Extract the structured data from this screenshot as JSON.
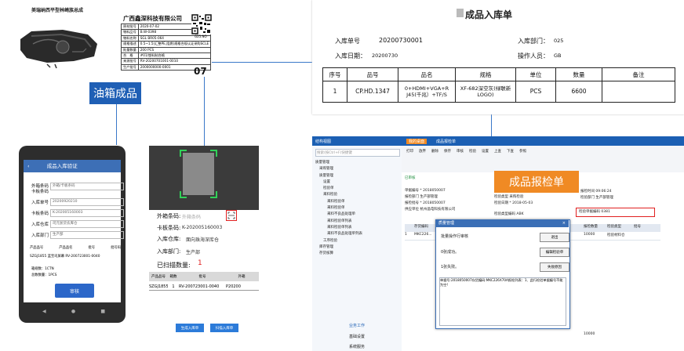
{
  "product_photo": {
    "caption": "美瑞纳西平型林崎族总成"
  },
  "label": {
    "company": "广西鑫深科技有限公司",
    "rows": [
      [
        "原材批号",
        "2020-07-02"
      ],
      [
        "物料品号",
        "B.W-0398"
      ],
      [
        "物料名称",
        "SGL BR05-064"
      ],
      [
        "规格描述",
        "0.5~1.5(汇整PE,阻燃)规格合规认证采购SCLE"
      ],
      [
        "批量数量",
        "200 PCS"
      ],
      [
        "合　格",
        "#01/塑料制合格"
      ],
      [
        "来源批号",
        "RV-20200701001-0010"
      ],
      [
        "生产批号",
        "2000000000-0001"
      ]
    ],
    "side_code": "G25.NO",
    "big_mark": "07"
  },
  "tank_title": "油箱成品",
  "inbound_doc": {
    "title": "成品入库单",
    "order_no_label": "入库单号",
    "order_no": "20200730001",
    "date_label": "入库日期：",
    "date": "20200730",
    "dept_label": "入库部门：",
    "dept": "025",
    "operator_label": "操作人员：",
    "operator": "GB",
    "columns": [
      "序号",
      "品号",
      "品名",
      "规格",
      "单位",
      "数量",
      "备注"
    ],
    "rows": [
      [
        "1",
        "CP.HD.1347",
        "0+HDMI+VGA+R J45(千兆）+TF/S",
        "XF-682深空灰(绿联新LOGO)",
        "PCS",
        "6600",
        ""
      ]
    ]
  },
  "phone": {
    "title": "成品入库验证",
    "outer_code_label": "外箱条码",
    "outer_code_placeholder": "外箱/卡板条码",
    "board_code_label": "卡板条码",
    "order_label": "入库单号",
    "order_value": "20200920210",
    "board_label": "卡板条码",
    "board_value": "K-202005160003",
    "warehouse_label": "入库仓库",
    "warehouse_value": "司元浙货农库仓",
    "dept_label": "入库部门",
    "dept_value": "生产部",
    "table_cols": [
      "产品品号",
      "产品品名",
      "批号",
      "批号码"
    ],
    "table_row": "SZGJ1855  蓝宝司屏幕  RV-200723001-0040",
    "pack_count": "箱规数：1CTN",
    "total_count": "总数数量：1PCS",
    "submit": "审核"
  },
  "scanner": {
    "outer_label": "外箱条码:",
    "outer_placeholder": "外箱条码",
    "board_label": "卡板条码:",
    "board_value": "K-202005160003",
    "warehouse_label": "入库仓库:",
    "warehouse_value": "面向珠海深库仓",
    "dept_label": "入库部门:",
    "dept_value": "生产部",
    "scanned_label": "已扫描数量:",
    "scanned_count": "1",
    "cols": [
      "产品品号",
      "箱数",
      "批号",
      "外箱"
    ],
    "row": [
      "SZGJ1855",
      "1",
      "RV-200723001-0040",
      "P20200"
    ],
    "btn_generate": "生成入库单",
    "btn_scan": "扫描入库单"
  },
  "erp": {
    "window_title": "结构视图",
    "tabs": [
      "我的桌面",
      "成品报检单"
    ],
    "search_placeholder": "搜索(按Ctrl+F)快捷键",
    "tree": [
      "质量管理",
      "采购管理",
      "质量管理",
      "设置",
      "检验单",
      "来料检验",
      "来料检验单",
      "来料检验单",
      "来料不良品处理单",
      "来料检验单列表",
      "来料检验单列表",
      "来料不良品处理单列表",
      "工序检验",
      "库存管理",
      "存货核算"
    ],
    "toolbar": [
      "打印",
      "放弃",
      "删除",
      "保存",
      "审核",
      "检验",
      "设置",
      "上查",
      "下查",
      "参照"
    ],
    "status": "已审核",
    "badge": "成品报检单",
    "fields": {
      "doc_no": "单据编号 * 2018050007",
      "dept": "报检部门 生产部管理",
      "qty": "报检批号 * 2018050007",
      "source": "供应单位 杭州晶电科技有限公司",
      "date1": "检验日期 * 2018-05-03",
      "item": "检验类型 采购检验",
      "time": "报检时间 09:06:24",
      "receiver": "检验部门 生产部管理",
      "code_label": "检验类型编码 ABK",
      "red_field": "检验单据编码 0381"
    },
    "grid_cols": [
      "",
      "存货编码",
      "",
      "报检数量",
      "检验类型",
      "批号"
    ],
    "grid_first": [
      "1",
      "MKC226...",
      "",
      "10000",
      "检验材料仓",
      ""
    ],
    "grid_total": "10000",
    "dialog": {
      "title": "质量管理",
      "line1": "批量操作行审核",
      "line2": "0张成功。",
      "line3": "1张失败。",
      "btn_exit": "退出",
      "btn_view": "编辑检验单",
      "btn_fail": "失败原因",
      "error": "单据号:2018050007存货编码:MKC226X70A报检列表：1、此行检验单据编号不能为空!"
    },
    "bottom_items": [
      "业务工作",
      "基础设置",
      "系统服务"
    ]
  }
}
